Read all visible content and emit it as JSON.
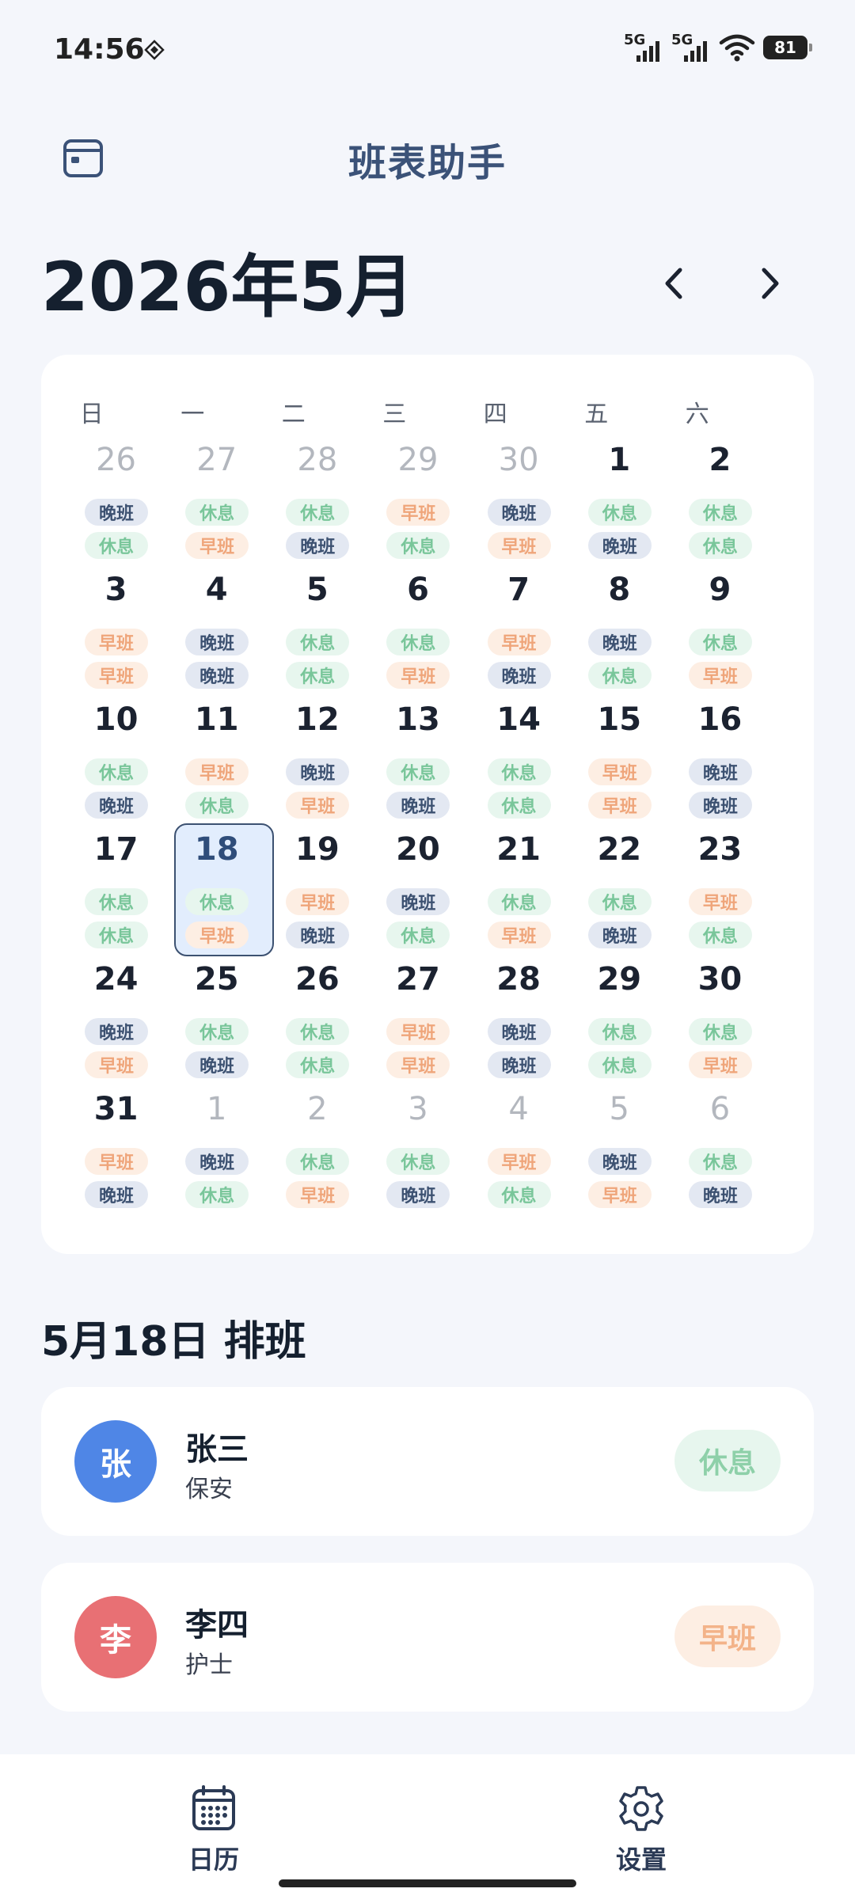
{
  "status_bar": {
    "time": "14:56",
    "signal_labels": [
      "5G",
      "5G"
    ],
    "battery": "81"
  },
  "header": {
    "title": "班表助手",
    "calendar_icon": "calendar-icon"
  },
  "month": {
    "title": "2026年5月",
    "prev": "‹",
    "next": "›"
  },
  "calendar": {
    "weekdays": [
      "日",
      "一",
      "二",
      "三",
      "四",
      "五",
      "六"
    ],
    "weeks": [
      [
        {
          "num": "26",
          "other": true,
          "shifts": [
            "晚班",
            "休息"
          ]
        },
        {
          "num": "27",
          "other": true,
          "shifts": [
            "休息",
            "早班"
          ]
        },
        {
          "num": "28",
          "other": true,
          "shifts": [
            "休息",
            "晚班"
          ]
        },
        {
          "num": "29",
          "other": true,
          "shifts": [
            "早班",
            "休息"
          ]
        },
        {
          "num": "30",
          "other": true,
          "shifts": [
            "晚班",
            "早班"
          ]
        },
        {
          "num": "1",
          "other": false,
          "shifts": [
            "休息",
            "晚班"
          ]
        },
        {
          "num": "2",
          "other": false,
          "shifts": [
            "休息",
            "休息"
          ]
        }
      ],
      [
        {
          "num": "3",
          "other": false,
          "shifts": [
            "早班",
            "早班"
          ]
        },
        {
          "num": "4",
          "other": false,
          "shifts": [
            "晚班",
            "晚班"
          ]
        },
        {
          "num": "5",
          "other": false,
          "shifts": [
            "休息",
            "休息"
          ]
        },
        {
          "num": "6",
          "other": false,
          "shifts": [
            "休息",
            "早班"
          ]
        },
        {
          "num": "7",
          "other": false,
          "shifts": [
            "早班",
            "晚班"
          ]
        },
        {
          "num": "8",
          "other": false,
          "shifts": [
            "晚班",
            "休息"
          ]
        },
        {
          "num": "9",
          "other": false,
          "shifts": [
            "休息",
            "早班"
          ]
        }
      ],
      [
        {
          "num": "10",
          "other": false,
          "shifts": [
            "休息",
            "晚班"
          ]
        },
        {
          "num": "11",
          "other": false,
          "shifts": [
            "早班",
            "休息"
          ]
        },
        {
          "num": "12",
          "other": false,
          "shifts": [
            "晚班",
            "早班"
          ]
        },
        {
          "num": "13",
          "other": false,
          "shifts": [
            "休息",
            "晚班"
          ]
        },
        {
          "num": "14",
          "other": false,
          "shifts": [
            "休息",
            "休息"
          ]
        },
        {
          "num": "15",
          "other": false,
          "shifts": [
            "早班",
            "早班"
          ]
        },
        {
          "num": "16",
          "other": false,
          "shifts": [
            "晚班",
            "晚班"
          ]
        }
      ],
      [
        {
          "num": "17",
          "other": false,
          "shifts": [
            "休息",
            "休息"
          ]
        },
        {
          "num": "18",
          "other": false,
          "selected": true,
          "shifts": [
            "休息",
            "早班"
          ]
        },
        {
          "num": "19",
          "other": false,
          "shifts": [
            "早班",
            "晚班"
          ]
        },
        {
          "num": "20",
          "other": false,
          "shifts": [
            "晚班",
            "休息"
          ]
        },
        {
          "num": "21",
          "other": false,
          "shifts": [
            "休息",
            "早班"
          ]
        },
        {
          "num": "22",
          "other": false,
          "shifts": [
            "休息",
            "晚班"
          ]
        },
        {
          "num": "23",
          "other": false,
          "shifts": [
            "早班",
            "休息"
          ]
        }
      ],
      [
        {
          "num": "24",
          "other": false,
          "shifts": [
            "晚班",
            "早班"
          ]
        },
        {
          "num": "25",
          "other": false,
          "shifts": [
            "休息",
            "晚班"
          ]
        },
        {
          "num": "26",
          "other": false,
          "shifts": [
            "休息",
            "休息"
          ]
        },
        {
          "num": "27",
          "other": false,
          "shifts": [
            "早班",
            "早班"
          ]
        },
        {
          "num": "28",
          "other": false,
          "shifts": [
            "晚班",
            "晚班"
          ]
        },
        {
          "num": "29",
          "other": false,
          "shifts": [
            "休息",
            "休息"
          ]
        },
        {
          "num": "30",
          "other": false,
          "shifts": [
            "休息",
            "早班"
          ]
        }
      ],
      [
        {
          "num": "31",
          "other": false,
          "shifts": [
            "早班",
            "晚班"
          ]
        },
        {
          "num": "1",
          "other": true,
          "shifts": [
            "晚班",
            "休息"
          ]
        },
        {
          "num": "2",
          "other": true,
          "shifts": [
            "休息",
            "早班"
          ]
        },
        {
          "num": "3",
          "other": true,
          "shifts": [
            "休息",
            "晚班"
          ]
        },
        {
          "num": "4",
          "other": true,
          "shifts": [
            "早班",
            "休息"
          ]
        },
        {
          "num": "5",
          "other": true,
          "shifts": [
            "晚班",
            "早班"
          ]
        },
        {
          "num": "6",
          "other": true,
          "shifts": [
            "休息",
            "晚班"
          ]
        }
      ]
    ]
  },
  "schedule": {
    "title": "5月18日 排班",
    "people": [
      {
        "avatar": "张",
        "name": "张三",
        "role": "保安",
        "shift": "休息",
        "avatar_color": "#4f86e6"
      },
      {
        "avatar": "李",
        "name": "李四",
        "role": "护士",
        "shift": "早班",
        "avatar_color": "#e87074"
      }
    ]
  },
  "nav": {
    "calendar_label": "日历",
    "settings_label": "设置"
  },
  "colors": {
    "rest": "#79c69a",
    "early": "#efa57a",
    "late": "#3c5171",
    "accent": "#3b5278"
  }
}
